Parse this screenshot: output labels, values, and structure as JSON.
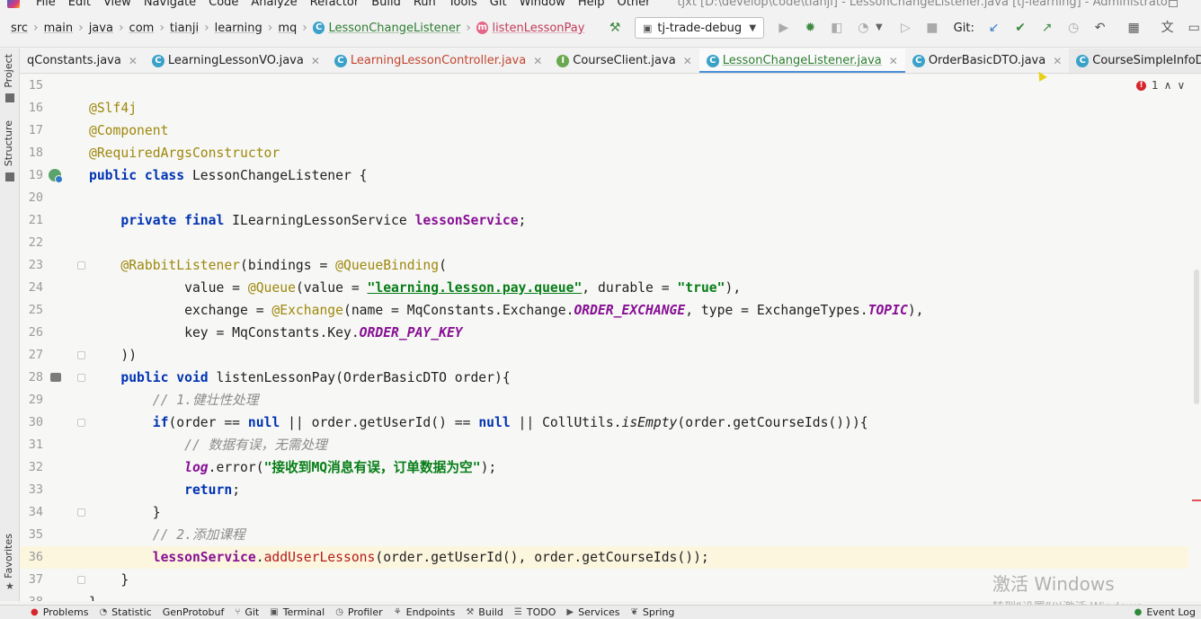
{
  "window": {
    "menu": [
      "File",
      "Edit",
      "View",
      "Navigate",
      "Code",
      "Analyze",
      "Refactor",
      "Build",
      "Run",
      "Tools",
      "Git",
      "Window",
      "Help",
      "Other"
    ],
    "title": "tjxt [D:\\develop\\code\\tianji] - LessonChangeListener.java [tj-learning] - Administrator"
  },
  "breadcrumb": {
    "items": [
      "src",
      "main",
      "java",
      "com",
      "tianji",
      "learning",
      "mq"
    ],
    "class_name": "LessonChangeListener",
    "method_name": "listenLessonPay"
  },
  "toolbar": {
    "run_config": "tj-trade-debug",
    "git_label": "Git:"
  },
  "tabs": [
    {
      "label": "qConstants.java",
      "icon": "none"
    },
    {
      "label": "LearningLessonVO.java",
      "icon": "class-icon"
    },
    {
      "label": "LearningLessonController.java",
      "icon": "class-icon"
    },
    {
      "label": "CourseClient.java",
      "icon": "interface-icon"
    },
    {
      "label": "LessonChangeListener.java",
      "icon": "class-icon",
      "active": true
    },
    {
      "label": "OrderBasicDTO.java",
      "icon": "class-icon"
    },
    {
      "label": "CourseSimpleInfoDTO.java",
      "icon": "class-icon"
    }
  ],
  "left_tools": [
    "Project",
    "Structure",
    "Favorites"
  ],
  "editor": {
    "current_line": 36,
    "line_numbers": [
      "15",
      "16",
      "17",
      "18",
      "19",
      "20",
      "21",
      "22",
      "23",
      "24",
      "25",
      "26",
      "27",
      "28",
      "29",
      "30",
      "31",
      "32",
      "33",
      "34",
      "35",
      "36",
      "37",
      "38"
    ],
    "tokens": {
      "slf4j": "@Slf4j",
      "component": "@Component",
      "required_args": "@RequiredArgsConstructor",
      "public": "public",
      "class": "class",
      "class_name": " LessonChangeListener {",
      "private": "private",
      "final": "final",
      "service_type": " ILearningLessonService ",
      "service_field": "lessonService",
      "semicolon": ";",
      "rabbit_listener": "@RabbitListener",
      "bindings": "(bindings = ",
      "queue_binding": "@QueueBinding",
      "open_paren": "(",
      "value_eq": "value = ",
      "queue": "@Queue",
      "value_arg": "(value = ",
      "queue_name": "\"learning.lesson.pay.queue\"",
      "durable_eq": ", durable = ",
      "true_str": "\"true\"",
      "close_comma": "),",
      "exchange_eq": "exchange = ",
      "exchange": "@Exchange",
      "name_arg": "(name = MqConstants.Exchange.",
      "order_exchange": "ORDER_EXCHANGE",
      "type_arg": ", type = ExchangeTypes.",
      "topic": "TOPIC",
      "key_eq": "key = MqConstants.Key.",
      "order_pay_key": "ORDER_PAY_KEY",
      "close_binding": "))",
      "void": "void",
      "method_sig": " listenLessonPay(OrderBasicDTO order){",
      "comment1": "// 1.健壮性处理",
      "if": "if",
      "cond1": "(order == ",
      "null": "null",
      "cond2": " || order.getUserId() == ",
      "cond3": " || CollUtils.",
      "is_empty": "isEmpty",
      "cond4": "(order.getCourseIds())){",
      "comment2": "// 数据有误，无需处理",
      "log": "log",
      "error_call": ".error(",
      "error_msg": "\"接收到MQ消息有误，订单数据为空\"",
      "close_stmt": ");",
      "return": "return",
      "close_brace": "}",
      "comment3": "// 2.添加课程",
      "add_user_lessons": "addUserLessons",
      "add_args": "(order.getUserId(), order.getCourseIds());",
      "dot": "."
    }
  },
  "inspections": {
    "error_count": "1"
  },
  "watermark": {
    "line1": "激活 Windows",
    "line2": "转到“设置”以激活 Windows。"
  },
  "bottom_tools": [
    "Problems",
    "Statistic",
    "GenProtobuf",
    "Git",
    "Terminal",
    "Profiler",
    "Endpoints",
    "Build",
    "TODO",
    "Services",
    "Spring"
  ],
  "event_log": "Event Log"
}
